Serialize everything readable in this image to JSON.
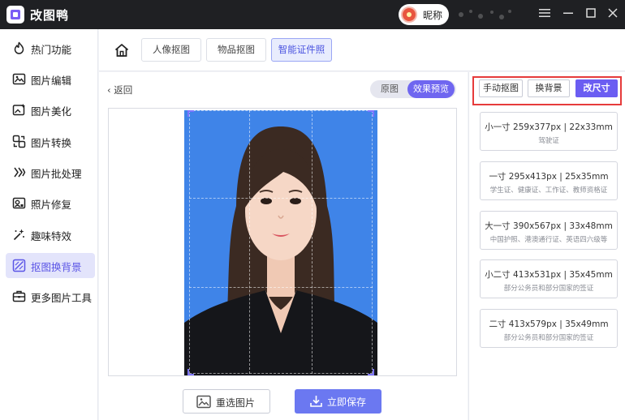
{
  "app": {
    "title": "改图鸭",
    "username": "昵称"
  },
  "sidebar": {
    "items": [
      {
        "label": "热门功能",
        "icon": "flame-icon"
      },
      {
        "label": "图片编辑",
        "icon": "image-edit-icon"
      },
      {
        "label": "图片美化",
        "icon": "image-beautify-icon"
      },
      {
        "label": "图片转换",
        "icon": "convert-icon"
      },
      {
        "label": "图片批处理",
        "icon": "batch-icon"
      },
      {
        "label": "照片修复",
        "icon": "repair-icon"
      },
      {
        "label": "趣味特效",
        "icon": "sparkle-icon"
      },
      {
        "label": "抠图换背景",
        "icon": "cutout-icon"
      },
      {
        "label": "更多图片工具",
        "icon": "toolbox-icon"
      }
    ],
    "active_index": 7
  },
  "tabs": [
    {
      "label": "人像抠图"
    },
    {
      "label": "物品抠图"
    },
    {
      "label": "智能证件照"
    }
  ],
  "active_tab": 2,
  "editor": {
    "back_label": "返回",
    "view_toggle": {
      "original": "原图",
      "preview": "效果预览",
      "selected": "preview"
    },
    "reselect_label": "重选图片",
    "save_label": "立即保存"
  },
  "right_panel": {
    "actions": {
      "manual_cutout": "手动抠图",
      "change_bg": "换背景",
      "change_size": "改尺寸"
    },
    "sizes": [
      {
        "main": "小一寸 259x377px | 22x33mm",
        "sub": "驾驶证"
      },
      {
        "main": "一寸 295x413px | 25x35mm",
        "sub": "学生证、健康证、工作证、教师资格证"
      },
      {
        "main": "大一寸 390x567px | 33x48mm",
        "sub": "中国护照、港澳通行证、英语四六级等"
      },
      {
        "main": "小二寸 413x531px | 35x45mm",
        "sub": "部分公务员和部分国家的签证"
      },
      {
        "main": "二寸 413x579px | 35x49mm",
        "sub": "部分公务员和部分国家的签证"
      }
    ]
  },
  "colors": {
    "accent": "#6b5df2",
    "photo_bg": "#3f84e8",
    "highlight": "#e63b3b"
  }
}
